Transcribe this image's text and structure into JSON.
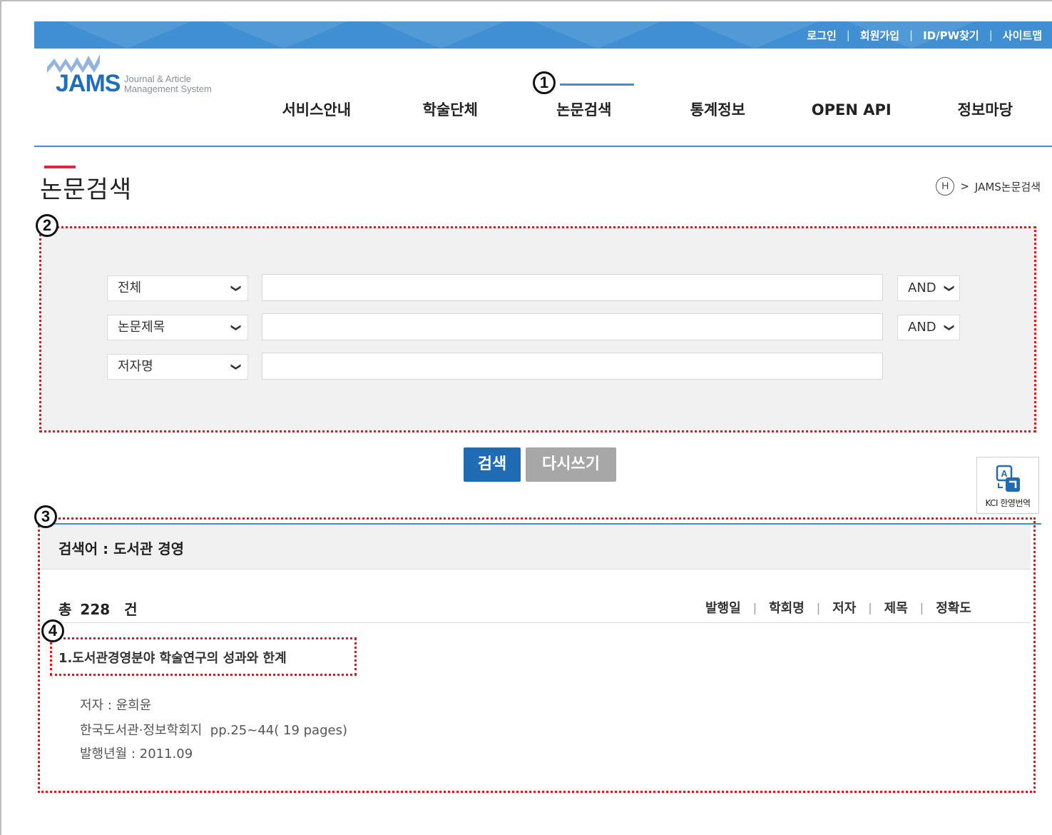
{
  "top_links": [
    "로그인",
    "회원가입",
    "ID/PW찾기",
    "사이트맵"
  ],
  "logo": {
    "name": "JAMS",
    "line1": "Journal & Article",
    "line2": "Management System"
  },
  "nav": [
    "서비스안내",
    "학술단체",
    "논문검색",
    "통계정보",
    "OPEN API",
    "정보마당"
  ],
  "nav_active": "논문검색",
  "page_title": "논문검색",
  "breadcrumb": {
    "home": "H",
    "sep": ">",
    "current": "JAMS논문검색"
  },
  "search": {
    "rows": [
      {
        "field": "전체",
        "query": "",
        "operator": "AND"
      },
      {
        "field": "논문제목",
        "query": "",
        "operator": "AND"
      },
      {
        "field": "저자명",
        "query": ""
      }
    ],
    "search_button": "검색",
    "reset_button": "다시쓰기"
  },
  "kci_label": "KCI 한영번역",
  "results": {
    "query_label": "검색어 : 도서관 경영",
    "total_prefix": "총",
    "total_count": "228",
    "total_suffix": "건",
    "sort_options": [
      "발행일",
      "학회명",
      "저자",
      "제목",
      "정확도"
    ],
    "items": [
      {
        "title": "1.도서관경영분야 학술연구의 성과와 한계",
        "author": "저자 : 윤희윤",
        "journal": "한국도서관·정보학회지",
        "pages": "pp.25~44( 19 pages)",
        "date": "발행년월 : 2011.09"
      }
    ]
  },
  "annotations": [
    "1",
    "2",
    "3",
    "4"
  ],
  "colors": {
    "brand_blue": "#3f8fd2",
    "button_blue": "#1f6cb5",
    "annotation_red": "#e5171c",
    "title_accent": "#e2263a"
  }
}
